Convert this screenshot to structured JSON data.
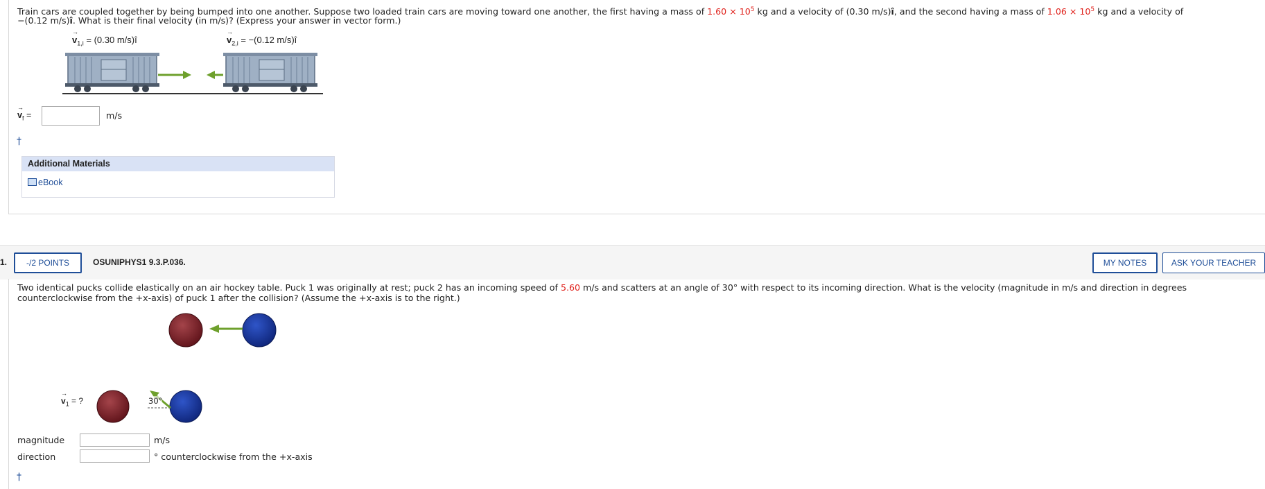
{
  "q1": {
    "prompt_part1": "Train cars are coupled together by being bumped into one another. Suppose two loaded train cars are moving toward one another, the first having a mass of",
    "mass1": "1.60 × 10",
    "mass_exp": "5",
    "prompt_part2": "kg and a velocity of (0.30 m/s)",
    "i_hat": "î",
    "prompt_part3": ", and the second having a mass of",
    "mass2": "1.06 × 10",
    "prompt_part4": "kg and a velocity of",
    "prompt_line2_a": "−(0.12 m/s)",
    "prompt_line2_b": ". What is their final velocity (in m/s)? (Express your answer in vector form.)",
    "fig_label1": "= (0.30 m/s)î",
    "fig_label1_sub": "1,i",
    "fig_label2": "= −(0.12 m/s)î",
    "fig_label2_sub": "2,i",
    "vf_label": "v",
    "vf_sub": "f",
    "vf_eq": "=",
    "vf_value": "",
    "vf_unit": "m/s",
    "dagger": "†",
    "additional_materials": "Additional Materials",
    "ebook": "eBook"
  },
  "q2": {
    "number": "1.",
    "points": "-/2 POINTS",
    "problem_id": "OSUNIPHYS1 9.3.P.036.",
    "my_notes": "MY NOTES",
    "ask_teacher": "ASK YOUR TEACHER",
    "prompt_a": "Two identical pucks collide elastically on an air hockey table. Puck 1 was originally at rest; puck 2 has an incoming speed of",
    "speed": "5.60",
    "prompt_b": "m/s and scatters at an angle of 30° with respect to its incoming direction. What is the velocity (magnitude in m/s and direction in degrees",
    "prompt_line2": "counterclockwise from the +x-axis) of puck 1 after the collision? (Assume the +x-axis is to the right.)",
    "fig_v1": "= ?",
    "fig_v1_sub": "1",
    "fig_angle": "30°",
    "magnitude_label": "magnitude",
    "magnitude_value": "",
    "magnitude_unit": "m/s",
    "direction_label": "direction",
    "direction_value": "",
    "direction_unit": "° counterclockwise from the +x-axis",
    "dagger": "†"
  },
  "colors": {
    "accent_blue": "#1f4e98",
    "given_red": "#e0221c",
    "arrow_green": "#6ea02c",
    "puck_red": "#7a1f24",
    "puck_blue": "#1c3a9e"
  }
}
